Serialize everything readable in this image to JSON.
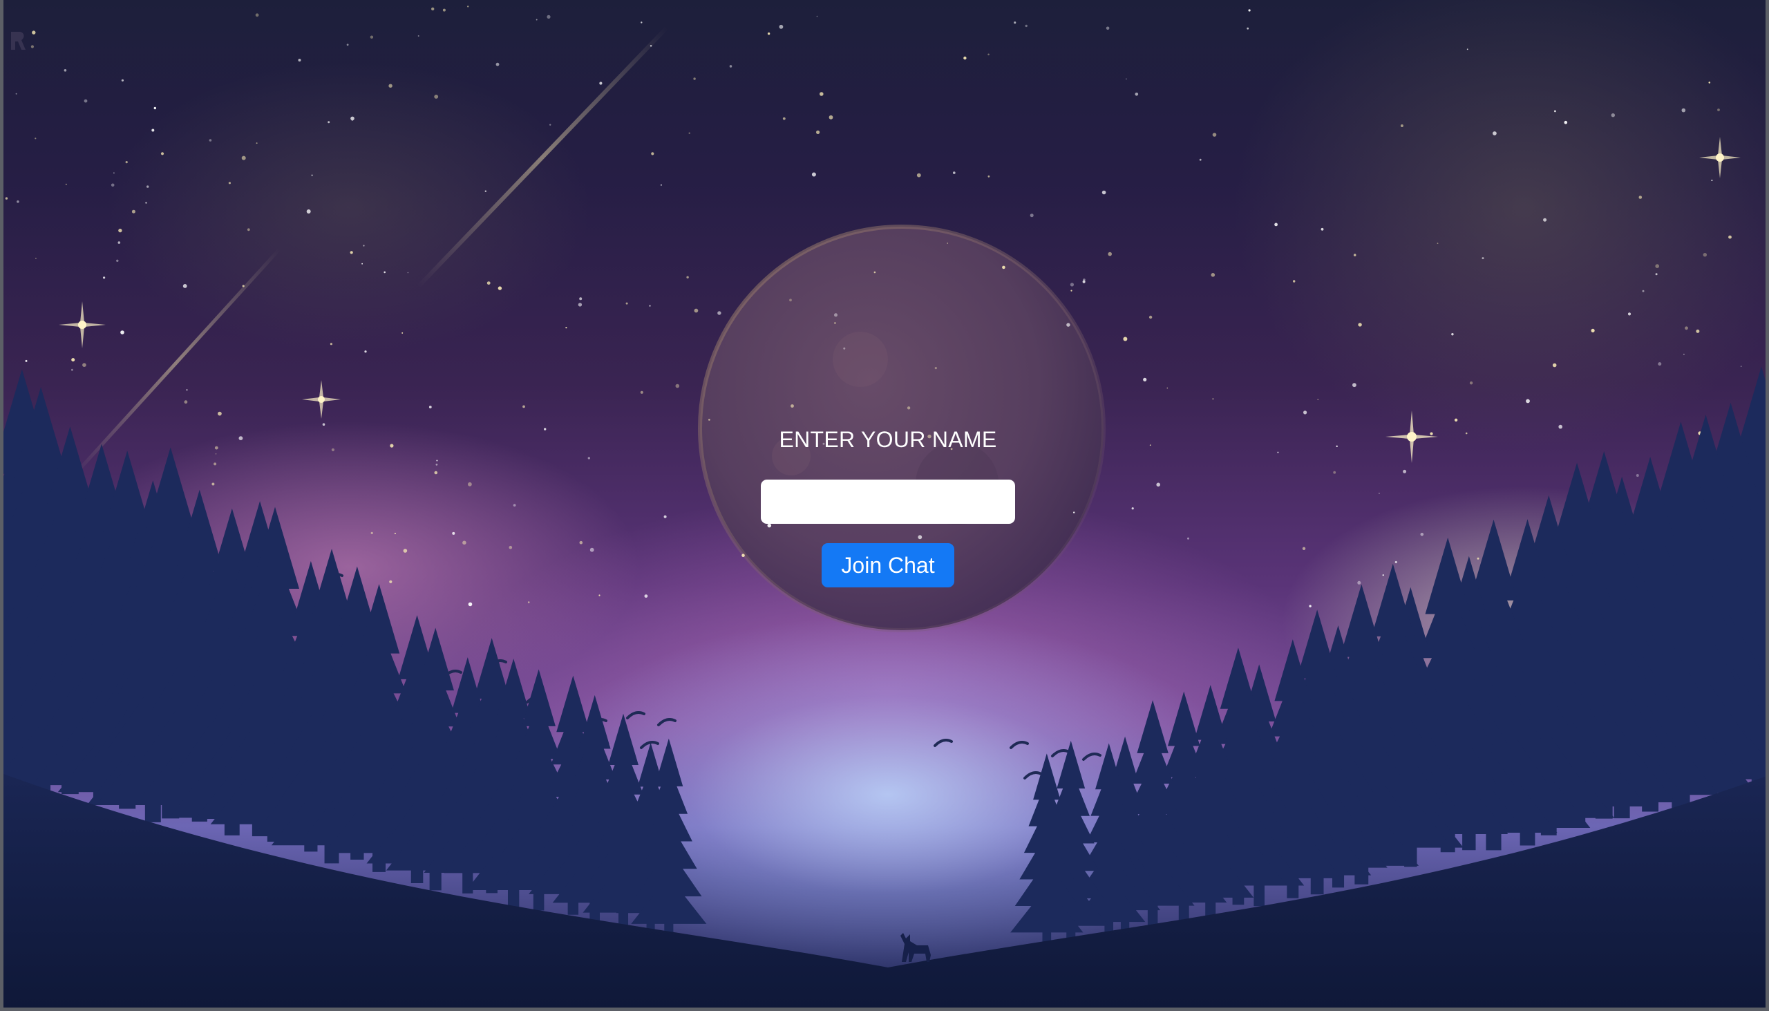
{
  "login": {
    "heading": "ENTER YOUR NAME",
    "name_input": {
      "value": "",
      "placeholder": ""
    },
    "join_label": "Join Chat"
  },
  "colors": {
    "button": "#1479f5",
    "text": "#ffffff",
    "input_background": "#ffffff"
  },
  "background": {
    "icon": "night-sky-forest-illustration"
  }
}
